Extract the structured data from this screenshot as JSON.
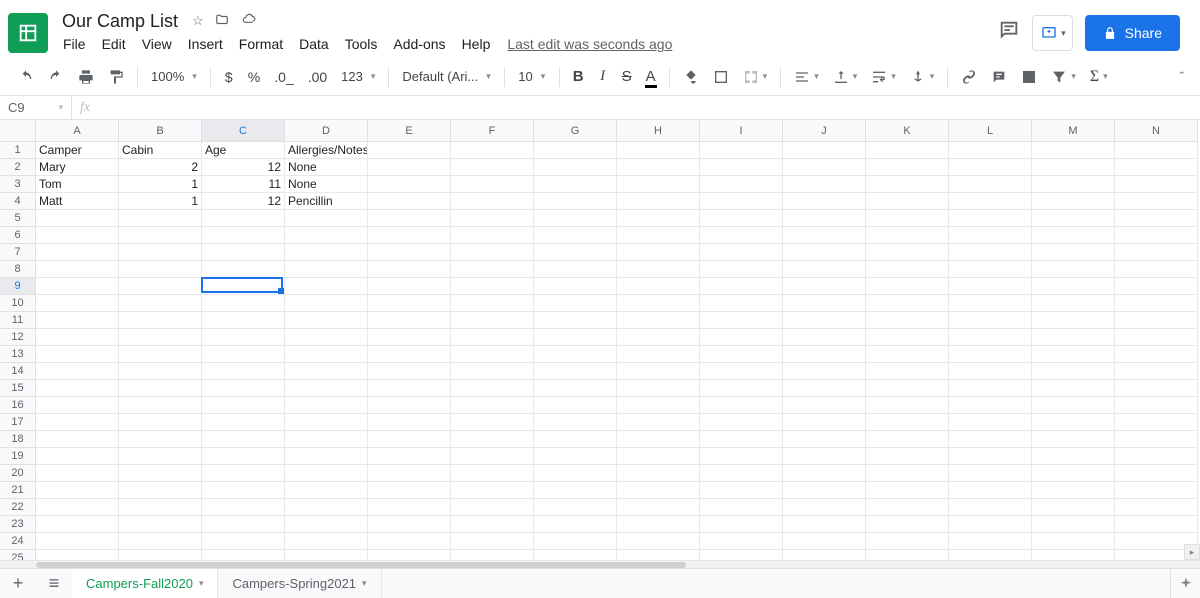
{
  "header": {
    "title": "Our Camp List",
    "menus": [
      "File",
      "Edit",
      "View",
      "Insert",
      "Format",
      "Data",
      "Tools",
      "Add-ons",
      "Help"
    ],
    "last_edit": "Last edit was seconds ago",
    "share_label": "Share"
  },
  "toolbar": {
    "zoom": "100%",
    "font": "Default (Ari...",
    "font_size": "10",
    "format_number": "123"
  },
  "formula": {
    "name_box": "C9",
    "fx": ""
  },
  "columns": [
    "A",
    "B",
    "C",
    "D",
    "E",
    "F",
    "G",
    "H",
    "I",
    "J",
    "K",
    "L",
    "M",
    "N"
  ],
  "row_count": 25,
  "selected_col_index": 2,
  "selected_row_index": 8,
  "cells": {
    "r1": {
      "A": "Camper",
      "B": "Cabin",
      "C": "Age",
      "D": "Allergies/Notes"
    },
    "r2": {
      "A": "Mary",
      "B": "2",
      "C": "12",
      "D": "None"
    },
    "r3": {
      "A": "Tom",
      "B": "1",
      "C": "11",
      "D": "None"
    },
    "r4": {
      "A": "Matt",
      "B": "1",
      "C": "12",
      "D": "Pencillin"
    }
  },
  "numeric_cols": [
    "B",
    "C"
  ],
  "sheets": {
    "active": "Campers-Fall2020",
    "other": "Campers-Spring2021"
  }
}
